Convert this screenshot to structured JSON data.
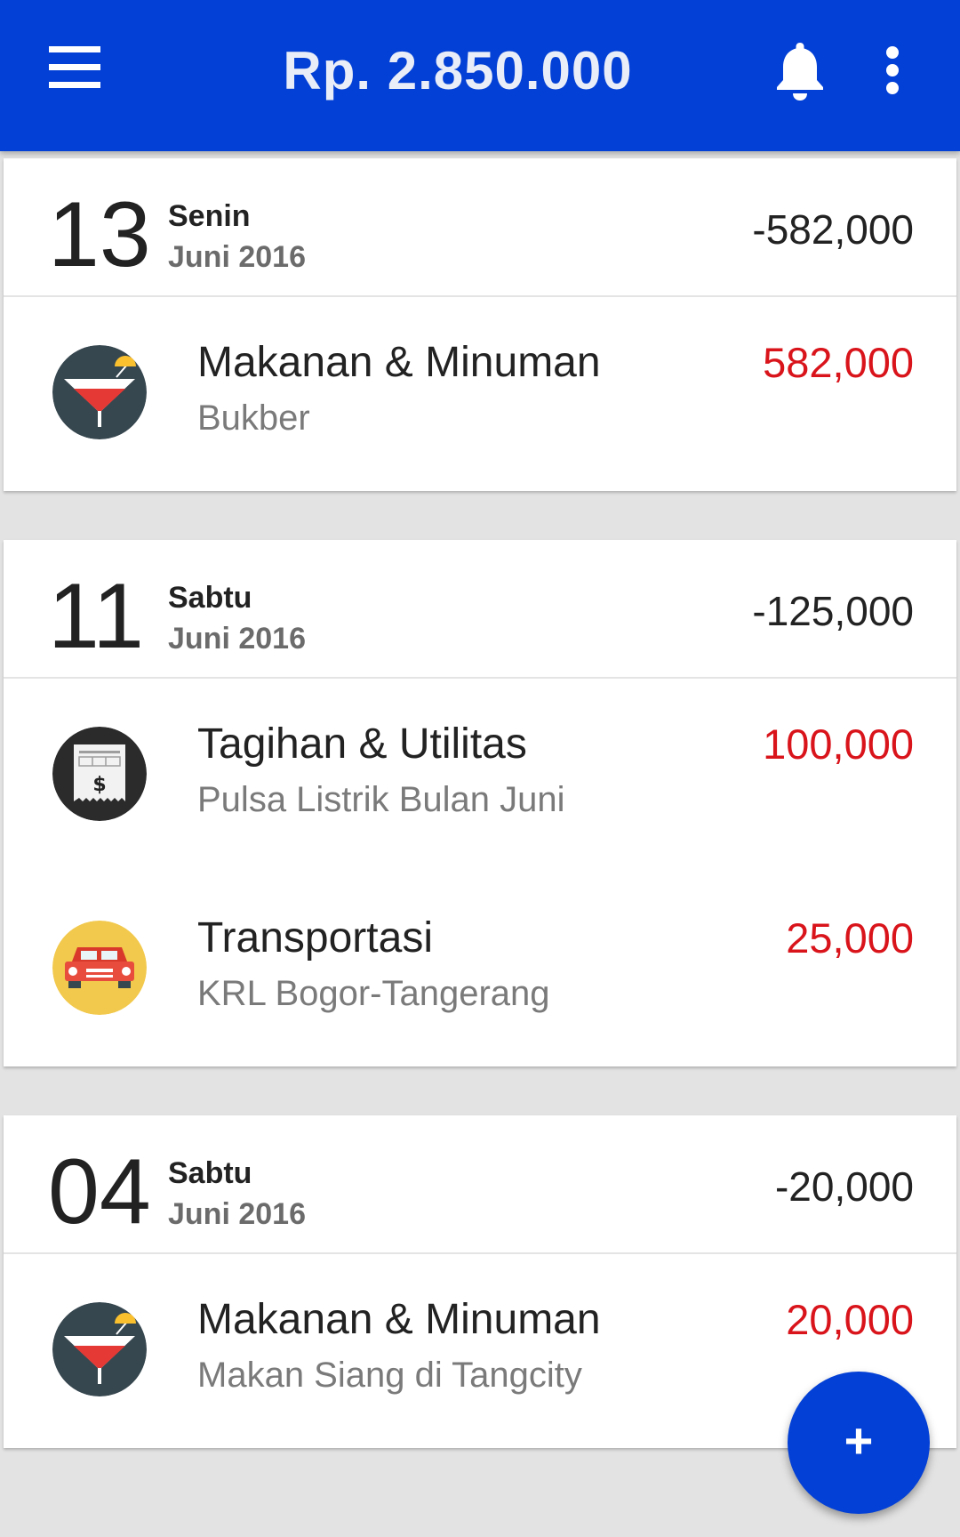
{
  "header": {
    "balance": "Rp. 2.850.000",
    "menu_icon": "hamburger-menu-icon",
    "bell_icon": "bell-icon",
    "more_icon": "more-vertical-icon",
    "color": "#0340d6"
  },
  "groups": [
    {
      "day": "13",
      "weekday": "Senin",
      "month": "Juni 2016",
      "total": "-582,000",
      "transactions": [
        {
          "category": "Makanan & Minuman",
          "note": "Bukber",
          "amount": "582,000",
          "icon": "cocktail-icon"
        }
      ]
    },
    {
      "day": "11",
      "weekday": "Sabtu",
      "month": "Juni 2016",
      "total": "-125,000",
      "transactions": [
        {
          "category": "Tagihan & Utilitas",
          "note": "Pulsa Listrik Bulan Juni",
          "amount": "100,000",
          "icon": "bill-receipt-icon"
        },
        {
          "category": "Transportasi",
          "note": "KRL Bogor-Tangerang",
          "amount": "25,000",
          "icon": "car-icon"
        }
      ]
    },
    {
      "day": "04",
      "weekday": "Sabtu",
      "month": "Juni 2016",
      "total": "-20,000",
      "transactions": [
        {
          "category": "Makanan & Minuman",
          "note": "Makan Siang di Tangcity",
          "amount": "20,000",
          "icon": "cocktail-icon"
        }
      ]
    }
  ],
  "fab": {
    "label": "+",
    "icon": "add-icon"
  },
  "colors": {
    "expense_amount": "#d9141b",
    "background": "#e3e3e3"
  }
}
